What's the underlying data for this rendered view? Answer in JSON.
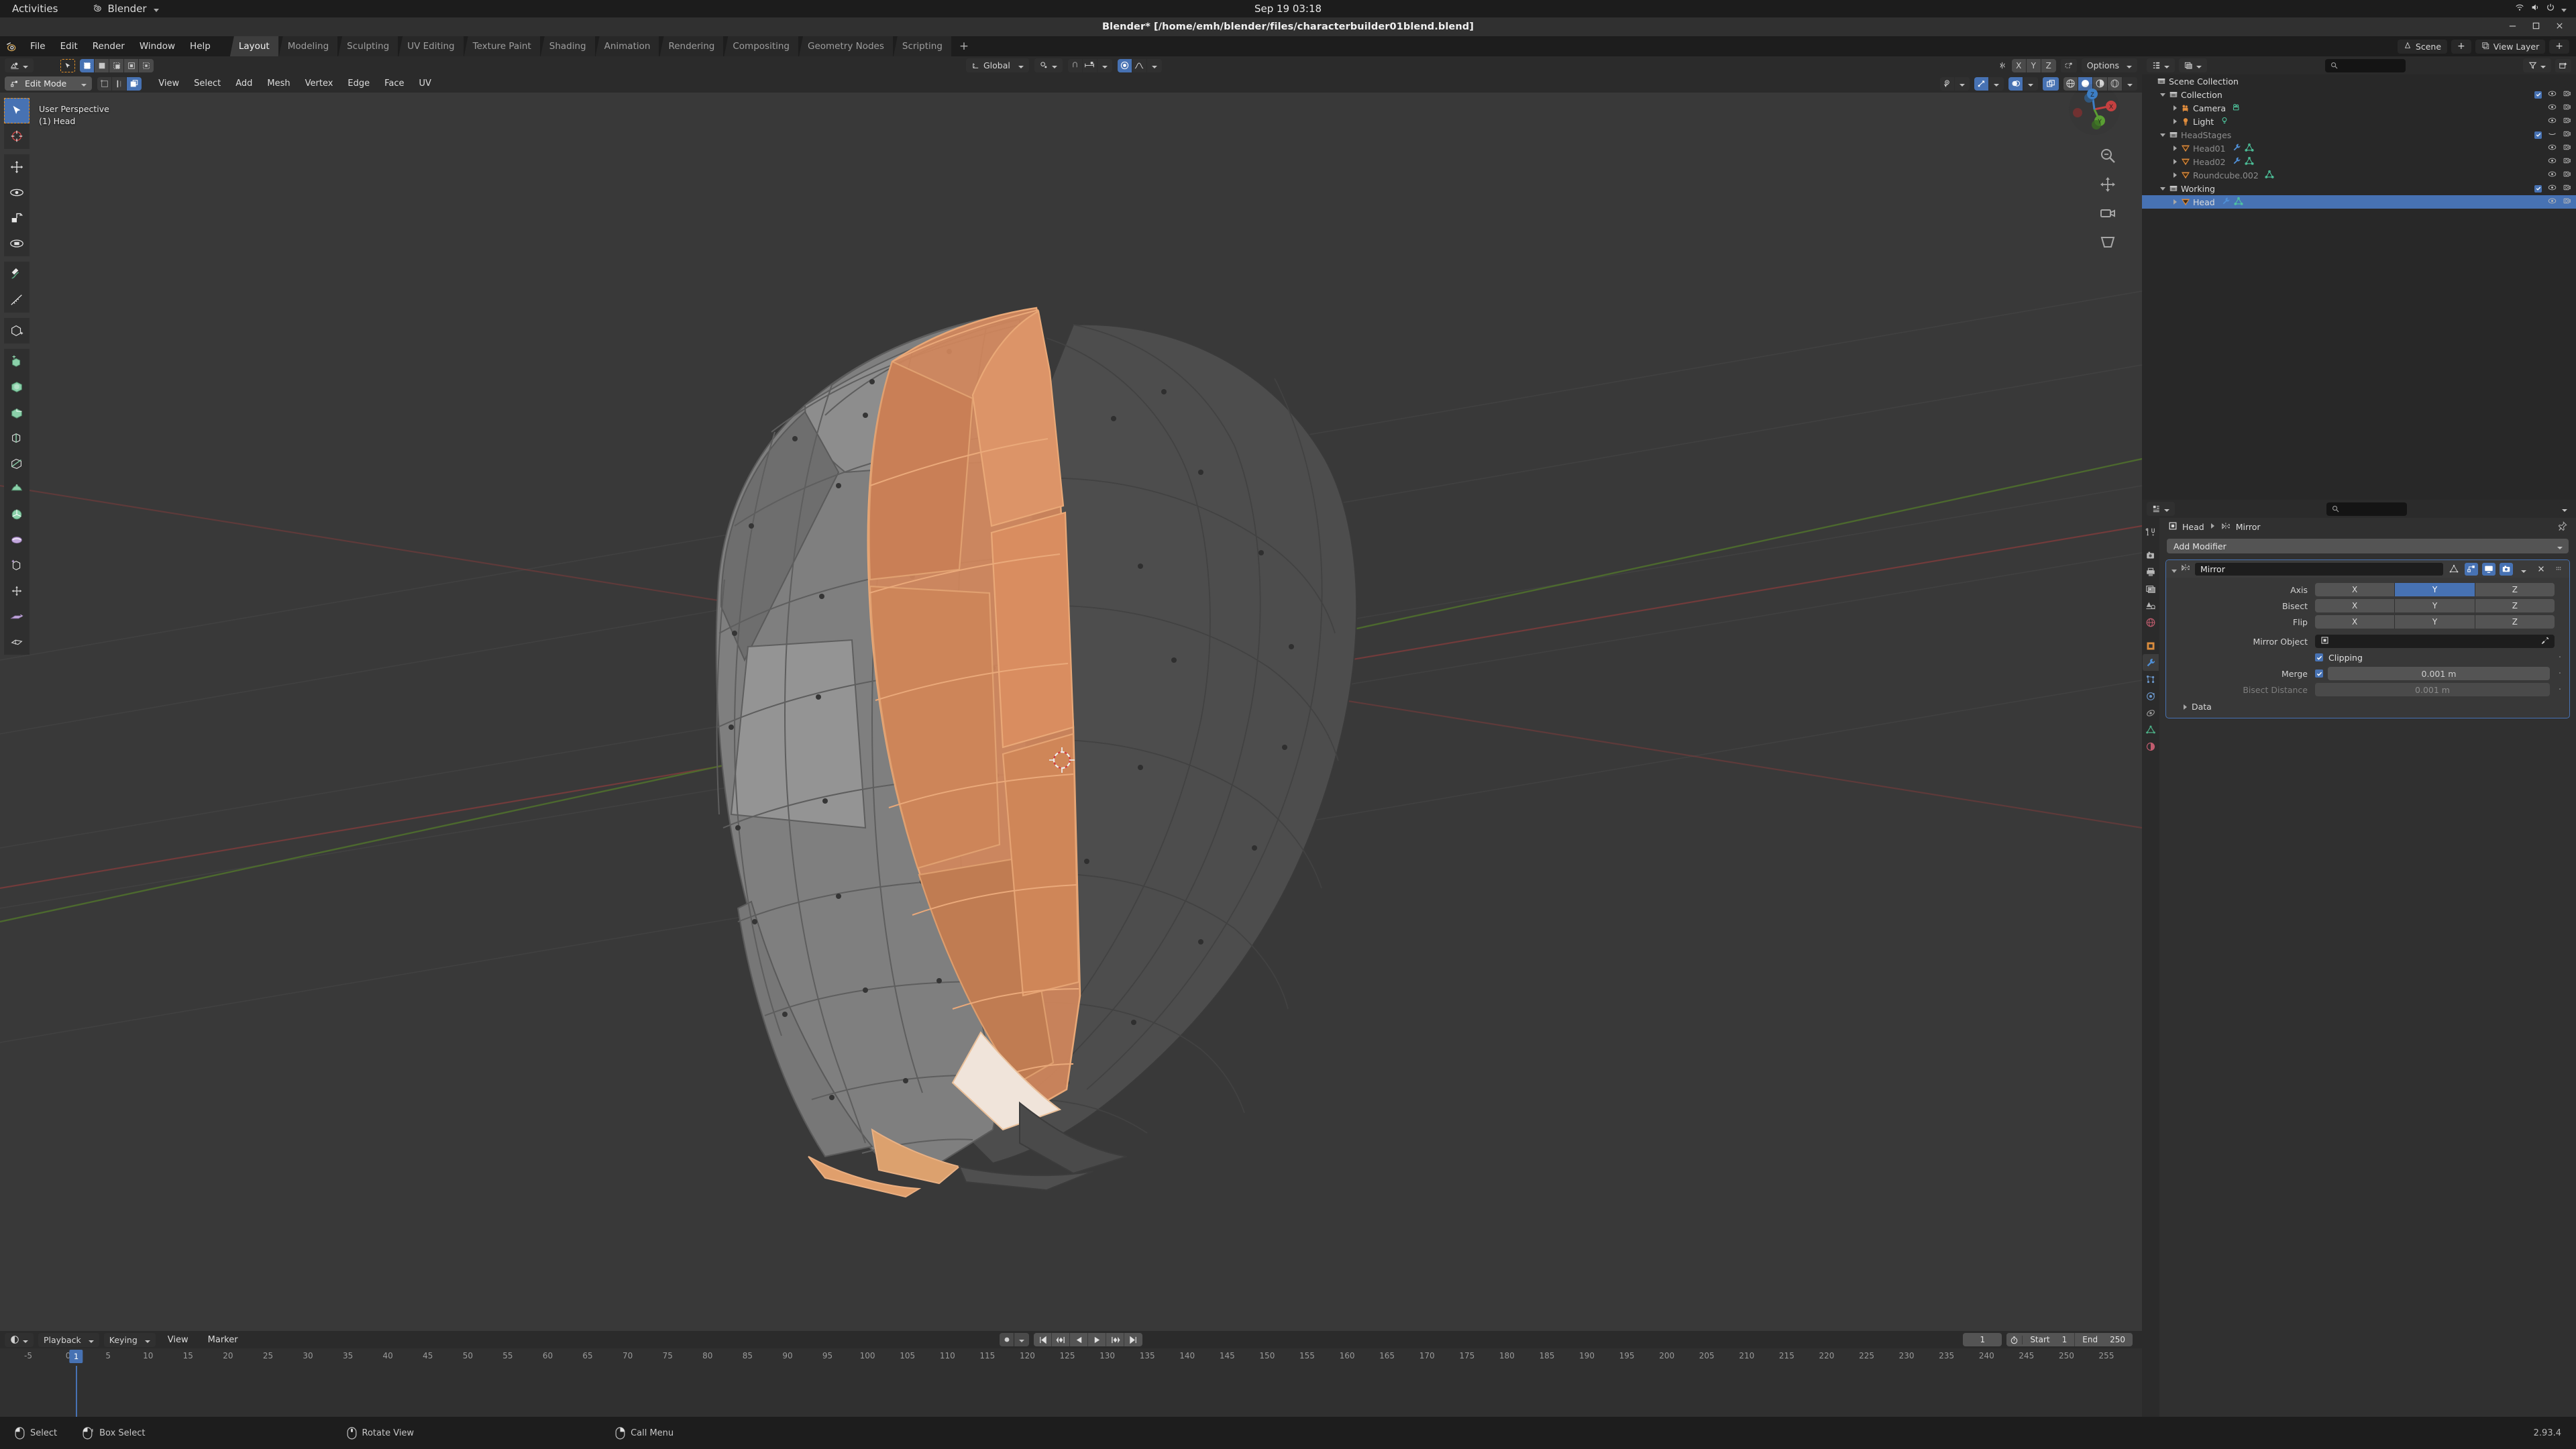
{
  "gnome": {
    "activities": "Activities",
    "app_name": "Blender",
    "app_icon": "blender-logo-icon",
    "clock": "Sep 19  03:18",
    "tray_icons": [
      "network-icon",
      "volume-icon",
      "power-icon"
    ]
  },
  "window": {
    "title": "Blender* [/home/emh/blender/files/characterbuilder01blend.blend]",
    "buttons": [
      "minimize",
      "maximize",
      "close"
    ]
  },
  "topbar": {
    "menus": [
      "File",
      "Edit",
      "Render",
      "Window",
      "Help"
    ],
    "workspaces": [
      {
        "label": "Layout",
        "active": true
      },
      {
        "label": "Modeling",
        "active": false
      },
      {
        "label": "Sculpting",
        "active": false
      },
      {
        "label": "UV Editing",
        "active": false
      },
      {
        "label": "Texture Paint",
        "active": false
      },
      {
        "label": "Shading",
        "active": false
      },
      {
        "label": "Animation",
        "active": false
      },
      {
        "label": "Rendering",
        "active": false
      },
      {
        "label": "Compositing",
        "active": false
      },
      {
        "label": "Geometry Nodes",
        "active": false
      },
      {
        "label": "Scripting",
        "active": false
      }
    ],
    "add_workspace": "+",
    "scene_name": "Scene",
    "view_layer_name": "View Layer"
  },
  "viewport": {
    "header": {
      "editor_type_icon": "editor-type-3dview-icon",
      "mode": "Edit Mode",
      "select_modes": [
        "vertex-select-icon",
        "edge-select-icon",
        "face-select-icon"
      ],
      "active_select_mode": 2,
      "menus": [
        "View",
        "Select",
        "Add",
        "Mesh",
        "Vertex",
        "Edge",
        "Face",
        "UV"
      ],
      "transform_orientation": "Global",
      "snap_enabled": false,
      "proportional_editing_enabled": true,
      "mirror_axes": [
        "X",
        "Y",
        "Z"
      ],
      "options_label": "Options",
      "mesh_edit_mode_icons": [
        "mesh-edit-mode-icon"
      ],
      "toggle_xray": false,
      "shading_modes": [
        "wireframe-icon",
        "solid-icon",
        "material-preview-icon",
        "rendered-icon"
      ],
      "active_shading_mode": 1
    },
    "overlay_text": {
      "perspective": "User Perspective",
      "collection_object": "(1) Head"
    },
    "toolbar": [
      {
        "name": "tweak-tool",
        "icon": "cursor-arrow-icon",
        "selected": true
      },
      {
        "name": "cursor-tool",
        "icon": "3d-cursor-icon",
        "selected": false
      },
      {
        "name": "move-tool",
        "icon": "move-arrows-icon",
        "selected": false
      },
      {
        "name": "rotate-tool",
        "icon": "rotate-icon",
        "selected": false
      },
      {
        "name": "scale-tool",
        "icon": "scale-icon",
        "selected": false
      },
      {
        "name": "transform-tool",
        "icon": "transform-icon",
        "selected": false
      },
      {
        "name": "annotate-tool",
        "icon": "pencil-icon",
        "selected": false
      },
      {
        "name": "measure-tool",
        "icon": "ruler-icon",
        "selected": false
      },
      {
        "name": "add-cube-tool",
        "icon": "add-cube-icon",
        "selected": false
      },
      {
        "name": "extrude-region-tool",
        "icon": "extrude-icon",
        "selected": false
      },
      {
        "name": "inset-faces-tool",
        "icon": "inset-faces-icon",
        "selected": false
      },
      {
        "name": "bevel-tool",
        "icon": "bevel-icon",
        "selected": false
      },
      {
        "name": "loop-cut-tool",
        "icon": "loop-cut-icon",
        "selected": false
      },
      {
        "name": "knife-tool",
        "icon": "knife-icon",
        "selected": false
      },
      {
        "name": "poly-build-tool",
        "icon": "poly-build-icon",
        "selected": false
      },
      {
        "name": "spin-tool",
        "icon": "spin-icon",
        "selected": false
      },
      {
        "name": "smooth-tool",
        "icon": "smooth-icon",
        "selected": false
      },
      {
        "name": "edge-slide-tool",
        "icon": "edge-slide-icon",
        "selected": false
      },
      {
        "name": "shrink-fatten-tool",
        "icon": "shrink-fatten-icon",
        "selected": false
      },
      {
        "name": "shear-tool",
        "icon": "shear-icon",
        "selected": false
      },
      {
        "name": "rip-region-tool",
        "icon": "rip-region-icon",
        "selected": false
      }
    ],
    "gizmo_axes": [
      "X",
      "Y",
      "Z"
    ],
    "nav_icons": [
      "zoom-icon",
      "move-view-icon",
      "camera-view-icon",
      "perspective-toggle-icon"
    ]
  },
  "outliner": {
    "display_mode_icon": "outliner-display-mode-icon",
    "filter_icon": "filter-icon",
    "new_collection_icon": "new-collection-icon",
    "search_placeholder": "",
    "search_icon": "search-icon",
    "rows": [
      {
        "label": "Scene Collection",
        "icon": "collection-icon",
        "indent": 0,
        "disclosure": "none",
        "dim": false,
        "selected": false,
        "extras": [],
        "checkbox": null,
        "eye": false,
        "camera": false
      },
      {
        "label": "Collection",
        "icon": "collection-icon",
        "indent": 1,
        "disclosure": "open",
        "dim": false,
        "selected": false,
        "extras": [],
        "checkbox": true,
        "eye": true,
        "camera": true
      },
      {
        "label": "Camera",
        "icon": "camera-object-icon",
        "indent": 2,
        "disclosure": "closed",
        "dim": false,
        "selected": false,
        "extras": [
          "camera-data-icon"
        ],
        "checkbox": null,
        "eye": true,
        "camera": true
      },
      {
        "label": "Light",
        "icon": "light-object-icon",
        "indent": 2,
        "disclosure": "closed",
        "dim": false,
        "selected": false,
        "extras": [
          "light-data-icon"
        ],
        "checkbox": null,
        "eye": true,
        "camera": true
      },
      {
        "label": "HeadStages",
        "icon": "collection-icon",
        "indent": 1,
        "disclosure": "open",
        "dim": true,
        "selected": false,
        "extras": [],
        "checkbox": true,
        "eye": "hidden",
        "camera": true
      },
      {
        "label": "Head01",
        "icon": "mesh-object-icon",
        "indent": 2,
        "disclosure": "closed",
        "dim": true,
        "selected": false,
        "extras": [
          "modifier-icon",
          "mesh-data-icon"
        ],
        "checkbox": null,
        "eye": true,
        "camera": true
      },
      {
        "label": "Head02",
        "icon": "mesh-object-icon",
        "indent": 2,
        "disclosure": "closed",
        "dim": true,
        "selected": false,
        "extras": [
          "modifier-icon",
          "mesh-data-icon"
        ],
        "checkbox": null,
        "eye": true,
        "camera": true
      },
      {
        "label": "Roundcube.002",
        "icon": "mesh-object-icon",
        "indent": 2,
        "disclosure": "closed",
        "dim": true,
        "selected": false,
        "extras": [
          "mesh-data-icon"
        ],
        "checkbox": null,
        "eye": true,
        "camera": true
      },
      {
        "label": "Working",
        "icon": "collection-icon",
        "indent": 1,
        "disclosure": "open",
        "dim": false,
        "selected": false,
        "extras": [],
        "checkbox": true,
        "eye": true,
        "camera": true
      },
      {
        "label": "Head",
        "icon": "mesh-object-icon",
        "indent": 2,
        "disclosure": "closed",
        "dim": false,
        "selected": true,
        "extras": [
          "modifier-icon",
          "mesh-data-icon"
        ],
        "checkbox": null,
        "eye": true,
        "camera": true
      }
    ]
  },
  "properties": {
    "editor_icon": "properties-editor-icon",
    "search_placeholder": "",
    "tabs": [
      {
        "name": "tool",
        "icon": "tool-icon",
        "active": false
      },
      {
        "name": "render",
        "icon": "render-camera-icon",
        "active": false
      },
      {
        "name": "output",
        "icon": "printer-icon",
        "active": false
      },
      {
        "name": "view-layer",
        "icon": "images-icon",
        "active": false
      },
      {
        "name": "scene",
        "icon": "scene-cone-icon",
        "active": false
      },
      {
        "name": "world",
        "icon": "world-globe-icon",
        "active": false
      },
      {
        "name": "object",
        "icon": "object-square-icon",
        "active": false
      },
      {
        "name": "modifiers",
        "icon": "wrench-icon",
        "active": true
      },
      {
        "name": "particles",
        "icon": "particles-icon",
        "active": false
      },
      {
        "name": "physics",
        "icon": "physics-orbit-icon",
        "active": false
      },
      {
        "name": "constraints",
        "icon": "constraints-icon",
        "active": false
      },
      {
        "name": "object-data",
        "icon": "mesh-data-triangle-icon",
        "active": false
      },
      {
        "name": "material",
        "icon": "material-sphere-icon",
        "active": false
      }
    ],
    "breadcrumb": [
      {
        "label": "Head",
        "icon": "object-square-icon"
      },
      {
        "label": "Mirror",
        "icon": "modifier-mirror-icon"
      }
    ],
    "pin_icon": "pin-icon",
    "add_modifier_label": "Add Modifier",
    "modifier": {
      "name": "Mirror",
      "icon": "modifier-mirror-icon",
      "expanded": true,
      "display_toggles": [
        {
          "name": "on-cage",
          "icon": "edit-mode-cage-icon",
          "on": false
        },
        {
          "name": "edit-mode-display",
          "icon": "edit-mode-icon",
          "on": true
        },
        {
          "name": "realtime-display",
          "icon": "monitor-icon",
          "on": true
        },
        {
          "name": "render-display",
          "icon": "camera-render-icon",
          "on": true
        }
      ],
      "extras_menu_icon": "chevron-down-icon",
      "close_icon": "x-icon",
      "drag_handle_icon": "drag-dots-icon",
      "rows": [
        {
          "label": "Axis",
          "type": "segments",
          "options": [
            "X",
            "Y",
            "Z"
          ],
          "active": [
            1
          ]
        },
        {
          "label": "Bisect",
          "type": "segments",
          "options": [
            "X",
            "Y",
            "Z"
          ],
          "active": []
        },
        {
          "label": "Flip",
          "type": "segments",
          "options": [
            "X",
            "Y",
            "Z"
          ],
          "active": []
        },
        {
          "label": "Mirror Object",
          "type": "object-field",
          "value": "",
          "icon": "object-square-icon",
          "eyedropper": "eyedropper-icon"
        },
        {
          "label": "Clipping",
          "type": "checkbox",
          "checked": true,
          "animate_dot": true
        },
        {
          "label": "Merge",
          "type": "checkbox-value",
          "checked": true,
          "value": "0.001 m",
          "animate_dot": true
        },
        {
          "label": "Bisect Distance",
          "type": "value-disabled",
          "value": "0.001 m",
          "animate_dot": true
        }
      ],
      "data_section_label": "Data"
    }
  },
  "timeline": {
    "editor_icon": "timeline-editor-icon",
    "menus": [
      {
        "label": "Playback",
        "dropdown": true
      },
      {
        "label": "Keying",
        "dropdown": true
      },
      {
        "label": "View",
        "dropdown": false
      },
      {
        "label": "Marker",
        "dropdown": false
      }
    ],
    "auto_keying_icon": "record-dot-icon",
    "jump_buttons": [
      "jump-to-start-icon",
      "jump-prev-keyframe-icon",
      "play-reverse-icon",
      "play-icon",
      "jump-next-keyframe-icon",
      "jump-to-end-icon"
    ],
    "current_frame": "1",
    "start_label": "Start",
    "start_value": "1",
    "end_label": "End",
    "end_value": "250",
    "timer_icon": "use-preview-range-icon",
    "playhead_frame": 1,
    "ruler_ticks": [
      -5,
      0,
      5,
      10,
      15,
      20,
      25,
      30,
      35,
      40,
      45,
      50,
      55,
      60,
      65,
      70,
      75,
      80,
      85,
      90,
      95,
      100,
      105,
      110,
      115,
      120,
      125,
      130,
      135,
      140,
      145,
      150,
      155,
      160,
      165,
      170,
      175,
      180,
      185,
      190,
      195,
      200,
      205,
      210,
      215,
      220,
      225,
      230,
      235,
      240,
      245,
      250,
      255
    ]
  },
  "statusbar": {
    "items": [
      {
        "icon": "mouse-left-icon",
        "label": "Select"
      },
      {
        "icon": "mouse-left-drag-icon",
        "label": "Box Select"
      },
      {
        "icon": "mouse-middle-icon",
        "label": "Rotate View"
      },
      {
        "icon": "mouse-right-icon",
        "label": "Call Menu"
      }
    ],
    "version": "2.93.4"
  },
  "colors": {
    "accent_blue": "#4772b3",
    "bg_dark": "#1d1d1d",
    "bg_panel": "#303030",
    "bg_header": "#2b2b2b",
    "viewport_bg": "#393939",
    "selected_face_orange": "#d98c5f",
    "mesh_grey": "#8a8a8a",
    "axis_red": "#a33b3b",
    "axis_green": "#5d8a33"
  }
}
